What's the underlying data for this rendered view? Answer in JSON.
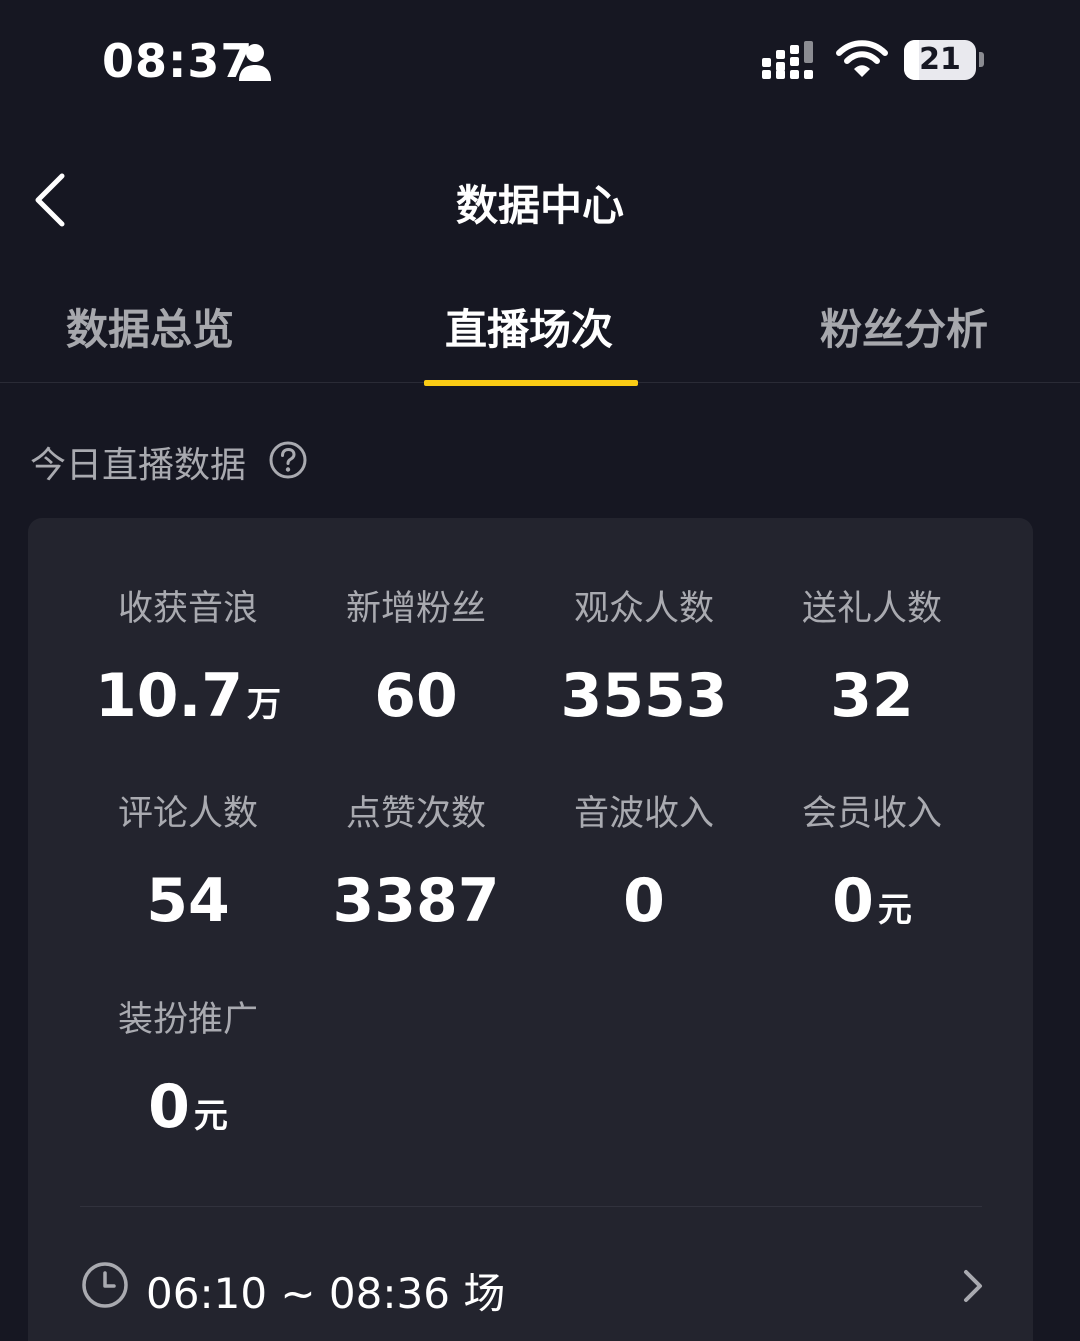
{
  "status_bar": {
    "time": "08:37",
    "battery": "21",
    "battery_level": 0.21,
    "icons": [
      "person-icon",
      "signal-icon",
      "wifi-icon",
      "battery-icon"
    ]
  },
  "nav": {
    "title": "数据中心",
    "back_icon": "chevron-left-icon"
  },
  "tabs": [
    {
      "label": "数据总览",
      "active": false
    },
    {
      "label": "直播场次",
      "active": true
    },
    {
      "label": "粉丝分析",
      "active": false
    }
  ],
  "section": {
    "title": "今日直播数据",
    "help_icon": "question-circle-icon"
  },
  "metrics": [
    {
      "label": "收获音浪",
      "value": "10.7",
      "unit": "万"
    },
    {
      "label": "新增粉丝",
      "value": "60",
      "unit": ""
    },
    {
      "label": "观众人数",
      "value": "3553",
      "unit": ""
    },
    {
      "label": "送礼人数",
      "value": "32",
      "unit": ""
    },
    {
      "label": "评论人数",
      "value": "54",
      "unit": ""
    },
    {
      "label": "点赞次数",
      "value": "3387",
      "unit": ""
    },
    {
      "label": "音波收入",
      "value": "0",
      "unit": ""
    },
    {
      "label": "会员收入",
      "value": "0",
      "unit": "元"
    },
    {
      "label": "装扮推广",
      "value": "0",
      "unit": "元"
    }
  ],
  "session": {
    "text": "06:10 ~ 08:36 场",
    "clock_icon": "clock-icon",
    "chevron_icon": "chevron-right-icon"
  },
  "colors": {
    "background": "#161722",
    "card": "#23242e",
    "accent": "#facc15",
    "muted_text": "#a9aab0",
    "text": "#ffffff"
  }
}
